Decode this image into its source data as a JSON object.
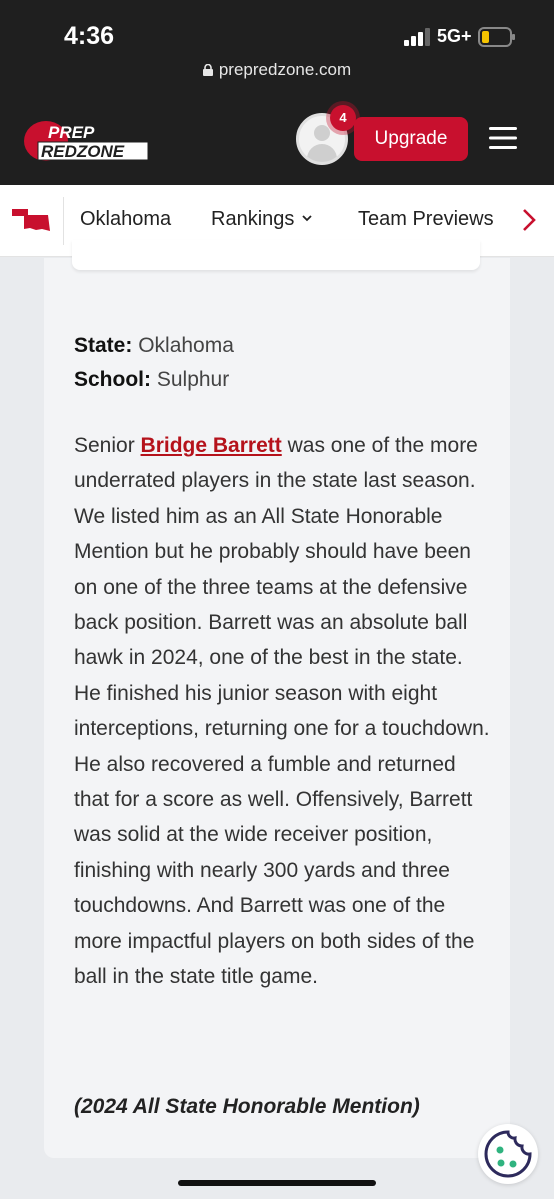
{
  "status_bar": {
    "time": "4:36",
    "network": "5G+",
    "url": "prepredzone.com"
  },
  "header": {
    "logo_line1": "PREP",
    "logo_line2": "REDZONE",
    "notification_count": "4",
    "upgrade_label": "Upgrade"
  },
  "subnav": {
    "items": [
      "Oklahoma",
      "Rankings",
      "Team Previews"
    ]
  },
  "article": {
    "state_label": "State:",
    "state_value": "Oklahoma",
    "school_label": "School:",
    "school_value": "Sulphur",
    "para_prefix": "Senior",
    "player_link": "Bridge Barrett",
    "para_body": "was one of the more underrated players in the state last season. We listed him as an All State Honorable Mention but he probably should have been on one of the three teams at the defensive back position. Barrett was an absolute ball hawk in 2024, one of the best in the state. He finished his junior season with eight interceptions, returning one for a touchdown. He also recovered a fumble and returned that for a score as well. Offensively, Barrett was solid at the wide receiver position, finishing with nearly 300 yards and three touchdowns. And Barrett was one of the more impactful players on both sides of the ball in the state title game.",
    "honor": "(2024 All State Honorable Mention)"
  },
  "colors": {
    "brand_red": "#c8102e",
    "link_red": "#b5121b",
    "dark_bg": "#1f1f1f"
  }
}
